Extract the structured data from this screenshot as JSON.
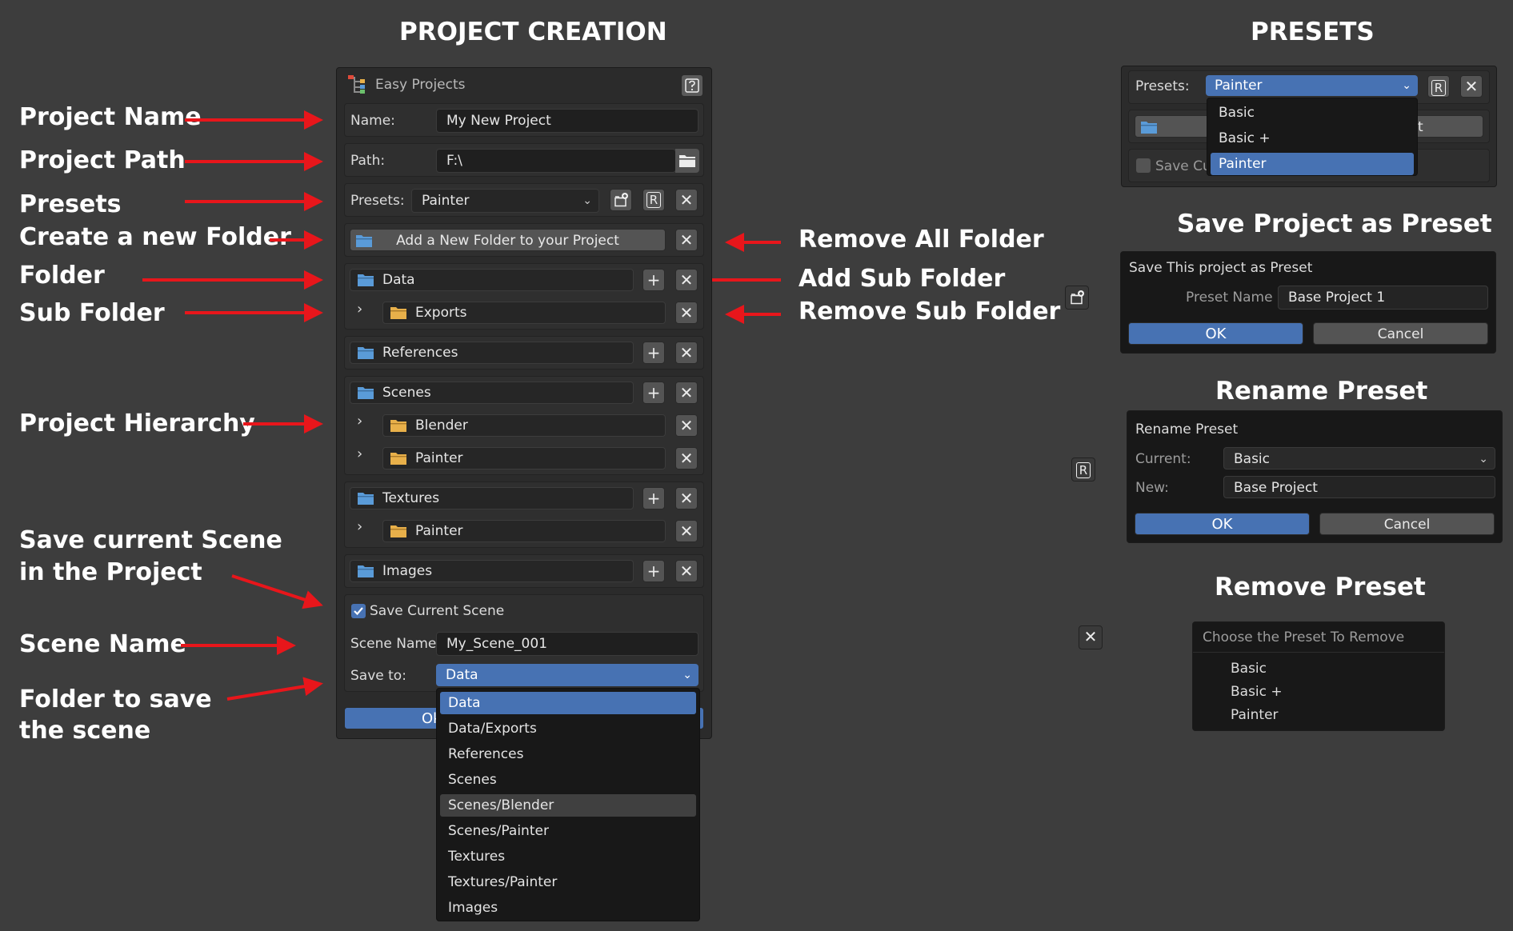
{
  "headings": {
    "project_creation": "PROJECT CREATION",
    "presets": "PRESETS",
    "save_project_as_preset": "Save Project as Preset",
    "rename_preset": "Rename Preset",
    "remove_preset": "Remove Preset"
  },
  "annotations": {
    "project_name": "Project Name",
    "project_path": "Project Path",
    "presets": "Presets",
    "create_new_folder": "Create a new Folder",
    "folder": "Folder",
    "sub_folder": "Sub Folder",
    "project_hierarchy": "Project Hierarchy",
    "save_scene_line1": "Save current Scene",
    "save_scene_line2": "in the Project",
    "scene_name": "Scene Name",
    "folder_to_save_line1": "Folder to save",
    "folder_to_save_line2": "the scene",
    "remove_all_folder": "Remove All Folder",
    "add_sub_folder": "Add Sub Folder",
    "remove_sub_folder": "Remove Sub Folder"
  },
  "main": {
    "title": "Easy Projects",
    "name_label": "Name:",
    "name_value": "My New Project",
    "path_label": "Path:",
    "path_value": "F:\\",
    "presets_label": "Presets:",
    "presets_value": "Painter",
    "rename_btn": "R",
    "add_folder_label": "Add a New Folder to your Project",
    "folders": [
      {
        "name": "Data",
        "subs": [
          "Exports"
        ]
      },
      {
        "name": "References",
        "subs": []
      },
      {
        "name": "Scenes",
        "subs": [
          "Blender",
          "Painter"
        ]
      },
      {
        "name": "Textures",
        "subs": [
          "Painter"
        ]
      },
      {
        "name": "Images",
        "subs": []
      }
    ],
    "save_scene_label": "Save Current Scene",
    "save_scene_checked": true,
    "scene_name_label": "Scene Name:",
    "scene_name_value": "My_Scene_001",
    "save_to_label": "Save to:",
    "save_to_value": "Data",
    "ok_partial": "Ok",
    "save_to_options": [
      "Data",
      "Data/Exports",
      "References",
      "Scenes",
      "Scenes/Blender",
      "Scenes/Painter",
      "Textures",
      "Textures/Painter",
      "Images"
    ]
  },
  "presets_panel": {
    "label": "Presets:",
    "value": "Painter",
    "rename_btn": "R",
    "options": [
      "Basic",
      "Basic +",
      "Painter"
    ],
    "save_partial": "Save Cu",
    "hidden_partial": "t"
  },
  "save_preset": {
    "header": "Save This project as Preset",
    "name_label": "Preset Name",
    "name_value": "Base Project 1",
    "ok": "OK",
    "cancel": "Cancel"
  },
  "rename_preset": {
    "header": "Rename Preset",
    "current_label": "Current:",
    "current_value": "Basic",
    "new_label": "New:",
    "new_value": "Base Project",
    "ok": "OK",
    "cancel": "Cancel",
    "icon_btn": "R"
  },
  "remove_preset": {
    "header": "Choose the Preset To Remove",
    "items": [
      "Basic",
      "Basic +",
      "Painter"
    ]
  },
  "colors": {
    "background": "#3d3d3d",
    "accent_blue": "#4772b3",
    "arrow_red": "#e8161b",
    "folder_blue": "#5a9bd8",
    "folder_yellow": "#e8b04a"
  }
}
